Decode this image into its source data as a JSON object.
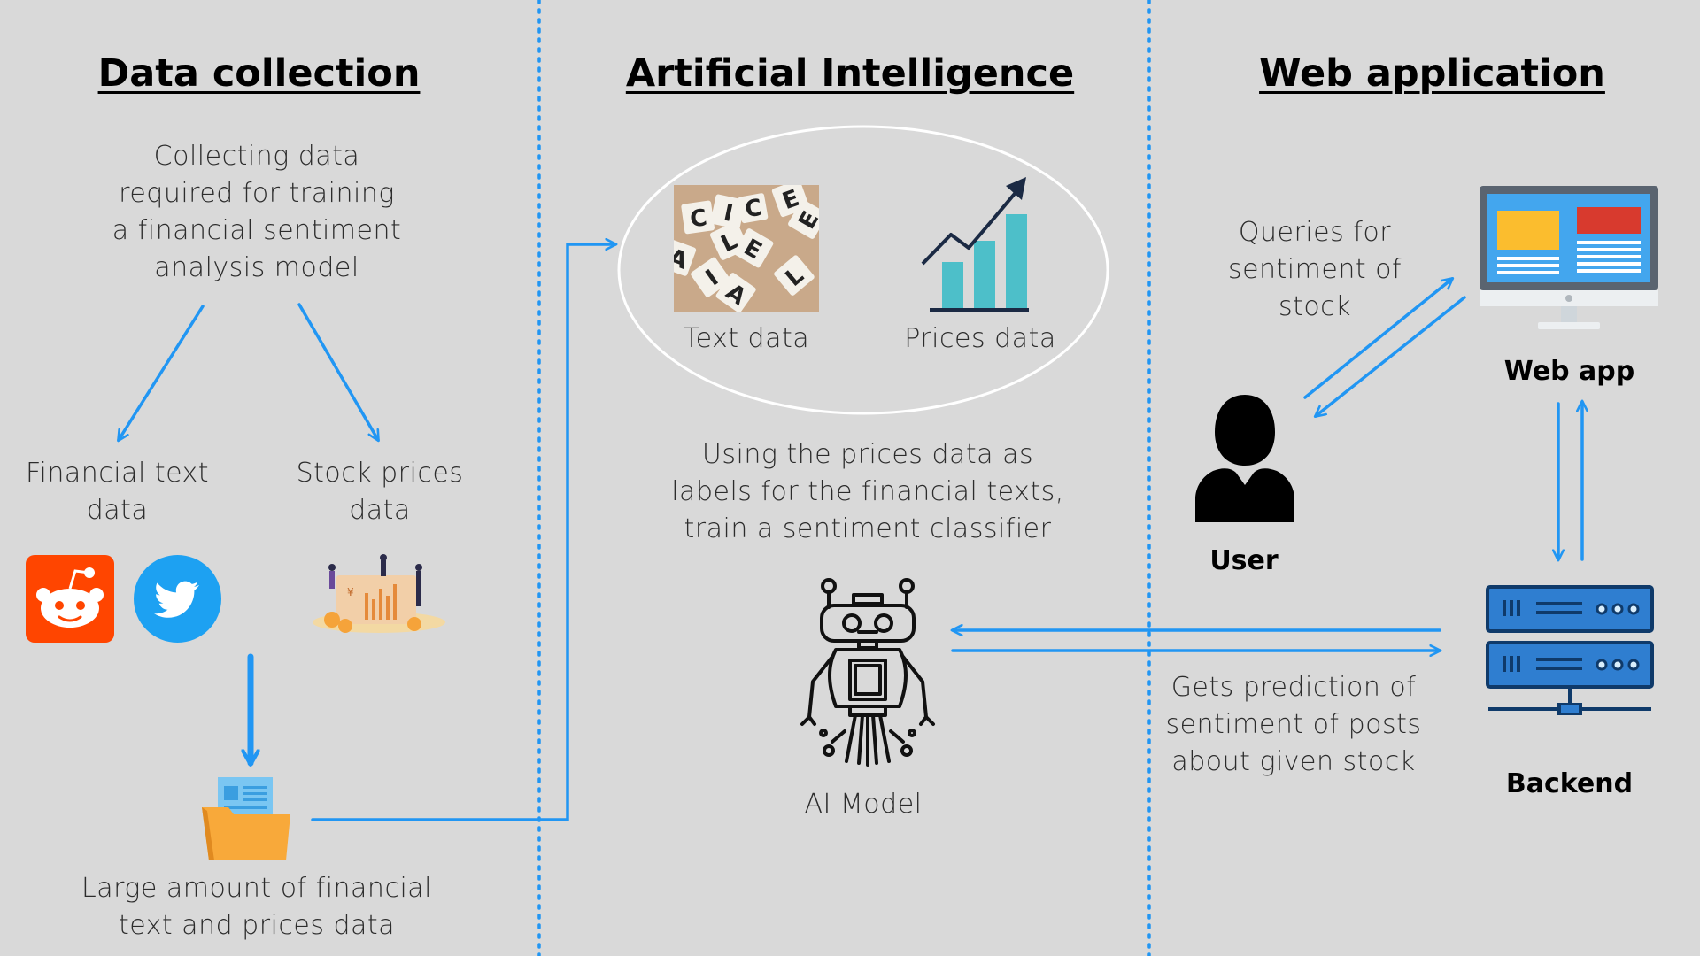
{
  "sections": {
    "data_collection": {
      "title": "Data collection",
      "description": [
        "Collecting data",
        "required for training",
        "a financial sentiment",
        "analysis model"
      ],
      "financial_text": [
        "Financial text",
        "data"
      ],
      "stock_prices": [
        "Stock prices",
        "data"
      ],
      "large_amount": [
        "Large amount of financial",
        "text and prices data"
      ]
    },
    "ai": {
      "title": "Artificial Intelligence",
      "text_data": "Text data",
      "prices_data": "Prices data",
      "description": [
        "Using the prices data as",
        "labels for the financial texts,",
        "train a sentiment classifier"
      ],
      "model_label": "AI Model"
    },
    "web": {
      "title": "Web application",
      "queries": [
        "Queries for",
        "sentiment of",
        "stock"
      ],
      "web_app": "Web app",
      "user": "User",
      "backend": "Backend",
      "prediction": [
        "Gets prediction of",
        "sentiment of posts",
        "about given stock"
      ]
    }
  },
  "colors": {
    "background": "#d9d9d9",
    "arrow": "#2196f3",
    "reddit": "#ff4500",
    "twitter": "#1da1f2",
    "server": "#1f5fa0",
    "folder": "#f8a93a"
  },
  "icons": [
    "reddit-icon",
    "twitter-icon",
    "stock-prices-illustration",
    "folder-icon",
    "text-tiles-image",
    "bar-chart-icon",
    "robot-icon",
    "monitor-icon",
    "user-icon",
    "server-icon"
  ]
}
